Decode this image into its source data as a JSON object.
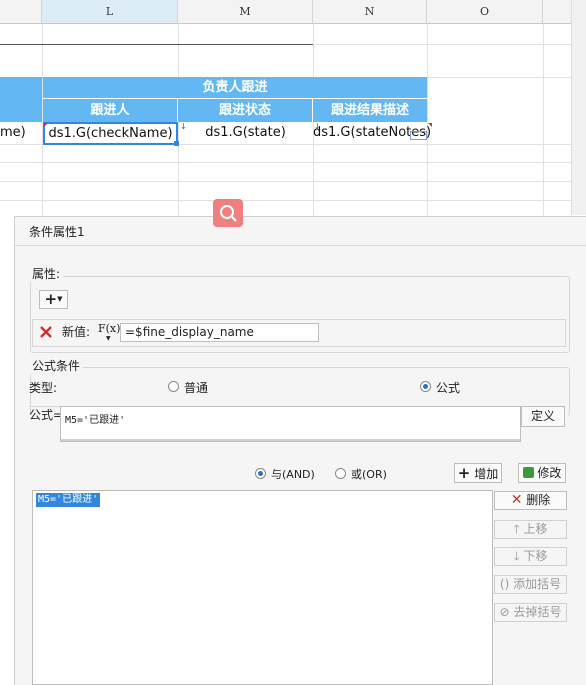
{
  "columns": {
    "L": "L",
    "M": "M",
    "N": "N",
    "O": "O"
  },
  "table": {
    "group_header": "负责人跟进",
    "headers": [
      "跟进人",
      "跟进状态",
      "跟进结果描述"
    ],
    "left_partial": "me)",
    "cells": [
      "ds1.G(checkName)",
      "ds1.G(state)",
      "ds1.G(stateNotes)"
    ]
  },
  "dialog": {
    "title": "条件属性1",
    "properties_label": "属性:",
    "add_symbol": "+",
    "new_value_label": "新值:",
    "fx_label": "F(x)",
    "new_value": "=$fine_display_name",
    "formula_condition_label": "公式条件",
    "type_label": "类型:",
    "type_options": [
      "普通",
      "公式"
    ],
    "type_selected": "公式",
    "formula_label": "公式=",
    "formula_value": "M5='已跟进'",
    "define_button": "定义",
    "logic_and": "与(AND)",
    "logic_or": "或(OR)",
    "logic_selected": "与(AND)",
    "add_button": "增加",
    "modify_button": "修改",
    "conditions": [
      "M5='已跟进'"
    ],
    "delete_button": "删除",
    "up_button": "上移",
    "down_button": "下移",
    "add_bracket_button": "添加括号",
    "remove_bracket_button": "去掉括号"
  },
  "colors": {
    "header_blue": "#63b8f3",
    "selection_blue": "#3388dd",
    "search_red": "#f07f7f"
  }
}
